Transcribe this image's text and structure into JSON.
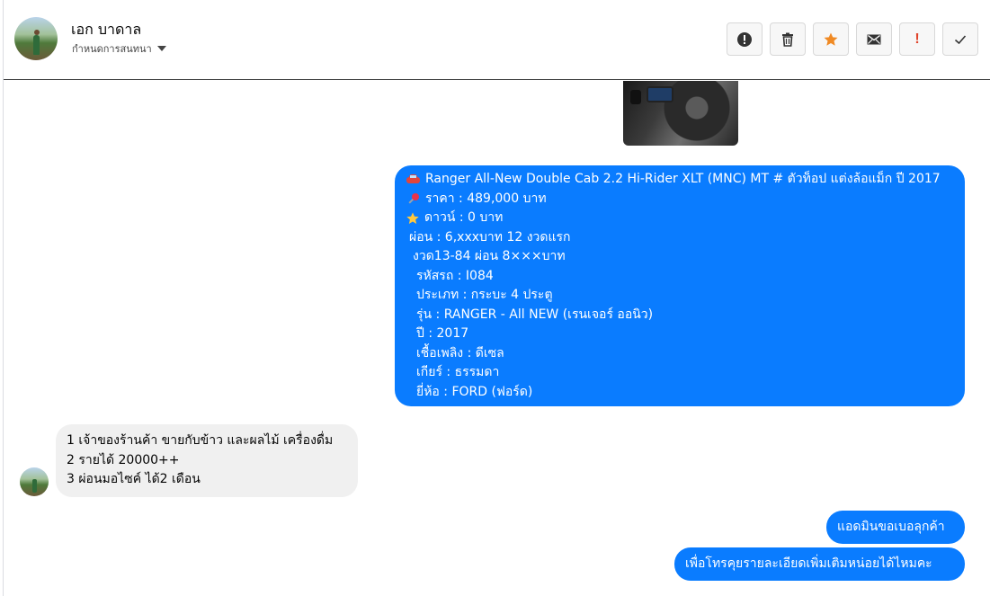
{
  "contact": {
    "name": "เอก บาดาล",
    "subtitle": "กำหนดการสนทนา"
  },
  "toolbar": {
    "icons": [
      "report-icon",
      "trash-icon",
      "star-icon",
      "mail-icon",
      "important-icon",
      "check-icon"
    ],
    "important_mark": "!",
    "accent_star": "#f08a24",
    "accent_important": "#e0442b"
  },
  "colors": {
    "outgoing_bubble": "#0a7cff",
    "incoming_bubble": "#f0f0f0"
  },
  "messages": {
    "listing": {
      "lines": [
        "Ranger All-New Double Cab 2.2 Hi-Rider XLT (MNC) MT # ตัวท็อป แต่งล้อแม็ก ปี 2017",
        "ราคา : 489,000 บาท",
        "ดาวน์ : 0 บาท",
        "ผ่อน : 6,xxxบาท 12 งวดแรก",
        "งวด13-84 ผ่อน 8×××บาท",
        "รหัสรถ : I084",
        "ประเภท : กระบะ 4 ประตู",
        "รุ่น : RANGER - All NEW (เรนเจอร์ ออนิว)",
        "ปี : 2017",
        "เชื้อเพลิง : ดีเซล",
        "เกียร์ : ธรรมดา",
        "ยี่ห้อ : FORD (ฟอร์ด)"
      ],
      "emojis": [
        "car-emoji",
        "pushpin-emoji",
        "star-emoji"
      ]
    },
    "incoming": {
      "lines": [
        "1 เจ้าของร้านค้า ขายกับข้าว และผลไม้ เครื่องดื่ม",
        "2 รายได้ 20000++",
        "3 ผ่อนมอไซค์ ได้2 เดือน"
      ]
    },
    "outgoing_short": [
      "แอดมินขอเบอลุกค้า",
      "เพื่อโทรคุยรายละเอียดเพิ่มเติมหน่อยได้ไหมคะ"
    ]
  }
}
